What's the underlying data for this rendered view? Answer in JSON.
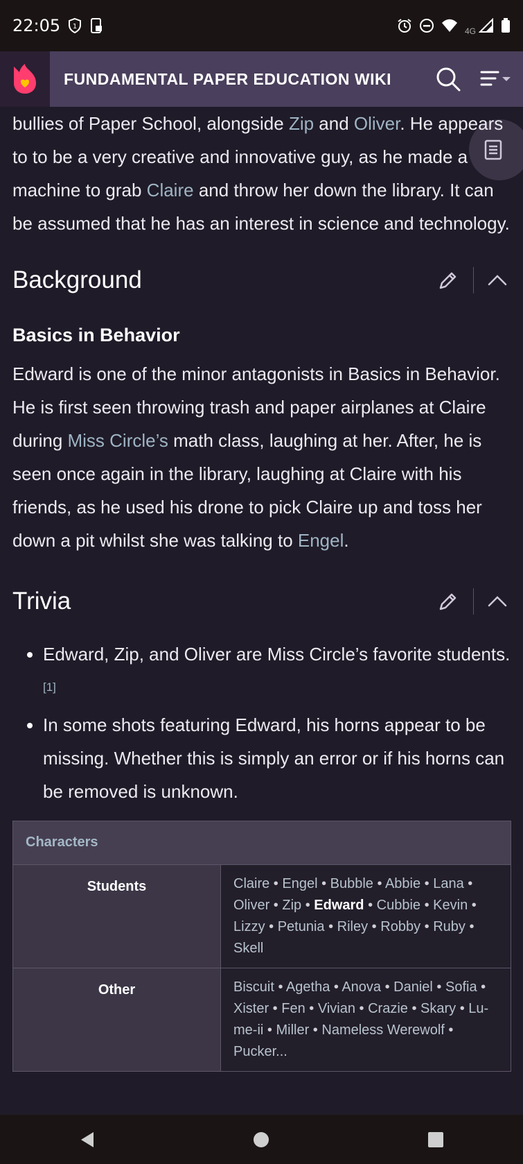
{
  "status_bar": {
    "time": "22:05",
    "network_label": "4G",
    "icons": [
      "shield-icon",
      "phone-screen-icon",
      "alarm-icon",
      "dnd-icon",
      "wifi-icon",
      "signal-icon",
      "battery-icon"
    ]
  },
  "header": {
    "title": "FUNDAMENTAL PAPER EDUCATION WIKI",
    "logo_color": "#ff3d6e",
    "background": "#4a3f5c"
  },
  "intro": {
    "parts": {
      "p1": "bullies of Paper School, alongside ",
      "link1": "Zip",
      "p2": " and ",
      "link2": "Oliver",
      "p3": ". He appears to to be a very creative and innovative guy, as he made a machine to grab ",
      "link3": "Claire",
      "p4": " and throw her down the library. It can be assumed that he has an interest in science and technology."
    }
  },
  "background_section": {
    "title": "Background",
    "subsection_title": "Basics in Behavior",
    "parts": {
      "p1": "Edward is one of the minor antagonists in Basics in Behavior. He is first seen throwing trash and paper airplanes at Claire during ",
      "link1": "Miss Circle’s",
      "p2": " math class, laughing at her. After, he is seen once again in the library, laughing at Claire with his friends, as he used his drone to pick Claire up and toss her down a pit whilst she was talking to ",
      "link2": "Engel",
      "p3": "."
    }
  },
  "trivia_section": {
    "title": "Trivia",
    "items": [
      {
        "text": "Edward, Zip, and Oliver are Miss Circle’s favorite students.",
        "ref": "[1]"
      },
      {
        "text": "In some shots featuring Edward, his horns appear to be missing. Whether this is simply an error or if his horns can be removed is unknown.",
        "ref": ""
      }
    ]
  },
  "navbox": {
    "title": "Characters",
    "groups": [
      {
        "label": "Students",
        "items": [
          "Claire",
          "Engel",
          "Bubble",
          "Abbie",
          "Lana",
          "Oliver",
          "Zip",
          "Edward",
          "Cubbie",
          "Kevin",
          "Lizzy",
          "Petunia",
          "Riley",
          "Robby",
          "Ruby",
          "Skell"
        ],
        "current": "Edward"
      },
      {
        "label": "Other",
        "items": [
          "Biscuit",
          "Agetha",
          "Anova",
          "Daniel",
          "Sofia",
          "Xister",
          "Fen",
          "Vivian",
          "Crazie",
          "Skary",
          "Lu-me-ii",
          "Miller",
          "Nameless Werewolf",
          "Pucker..."
        ],
        "current": ""
      }
    ]
  },
  "colors": {
    "page_bg": "#1f1b28",
    "link": "#9fb4c4",
    "status_bar": "#1a1414"
  }
}
